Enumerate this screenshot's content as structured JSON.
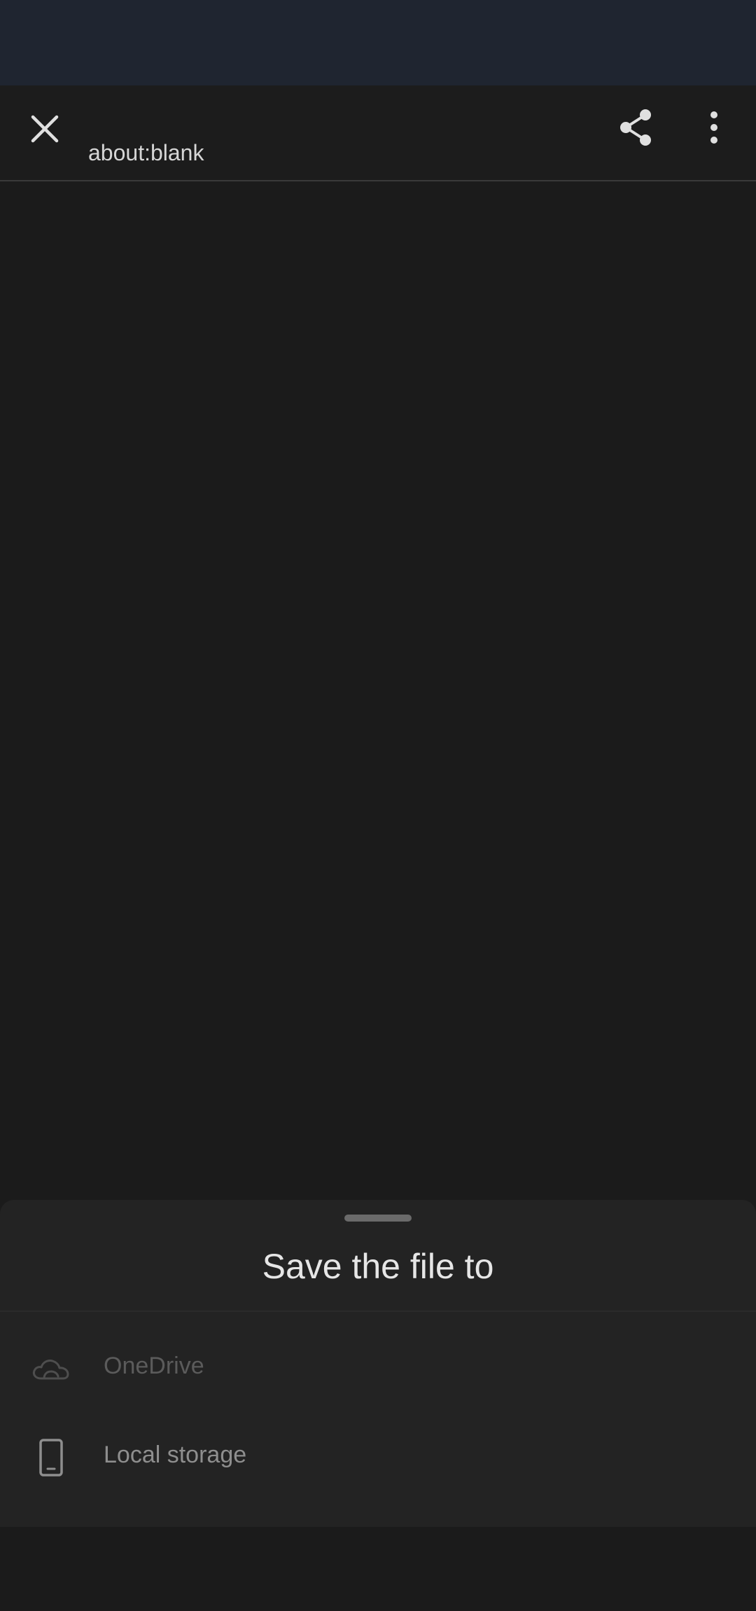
{
  "toolbar": {
    "url": "about:blank",
    "close_icon": "close-icon",
    "share_icon": "share-icon",
    "more_icon": "more-vert-icon"
  },
  "sheet": {
    "title": "Save the file to",
    "options": [
      {
        "label": "OneDrive",
        "icon": "cloud-icon",
        "enabled": false
      },
      {
        "label": "Local storage",
        "icon": "phone-icon",
        "enabled": true
      }
    ]
  },
  "colors": {
    "status_bar": "#1f2530",
    "toolbar_bg": "#1c1c1c",
    "page_bg": "#1b1b1b",
    "sheet_bg": "#232323"
  }
}
